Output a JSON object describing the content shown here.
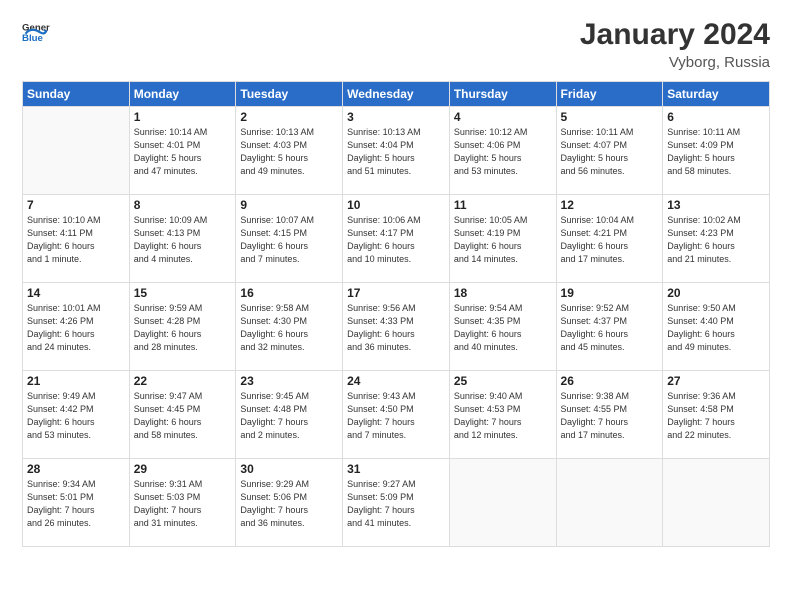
{
  "header": {
    "logo_general": "General",
    "logo_blue": "Blue",
    "month_year": "January 2024",
    "location": "Vyborg, Russia"
  },
  "weekdays": [
    "Sunday",
    "Monday",
    "Tuesday",
    "Wednesday",
    "Thursday",
    "Friday",
    "Saturday"
  ],
  "weeks": [
    [
      {
        "day": "",
        "info": ""
      },
      {
        "day": "1",
        "info": "Sunrise: 10:14 AM\nSunset: 4:01 PM\nDaylight: 5 hours\nand 47 minutes."
      },
      {
        "day": "2",
        "info": "Sunrise: 10:13 AM\nSunset: 4:03 PM\nDaylight: 5 hours\nand 49 minutes."
      },
      {
        "day": "3",
        "info": "Sunrise: 10:13 AM\nSunset: 4:04 PM\nDaylight: 5 hours\nand 51 minutes."
      },
      {
        "day": "4",
        "info": "Sunrise: 10:12 AM\nSunset: 4:06 PM\nDaylight: 5 hours\nand 53 minutes."
      },
      {
        "day": "5",
        "info": "Sunrise: 10:11 AM\nSunset: 4:07 PM\nDaylight: 5 hours\nand 56 minutes."
      },
      {
        "day": "6",
        "info": "Sunrise: 10:11 AM\nSunset: 4:09 PM\nDaylight: 5 hours\nand 58 minutes."
      }
    ],
    [
      {
        "day": "7",
        "info": "Sunrise: 10:10 AM\nSunset: 4:11 PM\nDaylight: 6 hours\nand 1 minute."
      },
      {
        "day": "8",
        "info": "Sunrise: 10:09 AM\nSunset: 4:13 PM\nDaylight: 6 hours\nand 4 minutes."
      },
      {
        "day": "9",
        "info": "Sunrise: 10:07 AM\nSunset: 4:15 PM\nDaylight: 6 hours\nand 7 minutes."
      },
      {
        "day": "10",
        "info": "Sunrise: 10:06 AM\nSunset: 4:17 PM\nDaylight: 6 hours\nand 10 minutes."
      },
      {
        "day": "11",
        "info": "Sunrise: 10:05 AM\nSunset: 4:19 PM\nDaylight: 6 hours\nand 14 minutes."
      },
      {
        "day": "12",
        "info": "Sunrise: 10:04 AM\nSunset: 4:21 PM\nDaylight: 6 hours\nand 17 minutes."
      },
      {
        "day": "13",
        "info": "Sunrise: 10:02 AM\nSunset: 4:23 PM\nDaylight: 6 hours\nand 21 minutes."
      }
    ],
    [
      {
        "day": "14",
        "info": "Sunrise: 10:01 AM\nSunset: 4:26 PM\nDaylight: 6 hours\nand 24 minutes."
      },
      {
        "day": "15",
        "info": "Sunrise: 9:59 AM\nSunset: 4:28 PM\nDaylight: 6 hours\nand 28 minutes."
      },
      {
        "day": "16",
        "info": "Sunrise: 9:58 AM\nSunset: 4:30 PM\nDaylight: 6 hours\nand 32 minutes."
      },
      {
        "day": "17",
        "info": "Sunrise: 9:56 AM\nSunset: 4:33 PM\nDaylight: 6 hours\nand 36 minutes."
      },
      {
        "day": "18",
        "info": "Sunrise: 9:54 AM\nSunset: 4:35 PM\nDaylight: 6 hours\nand 40 minutes."
      },
      {
        "day": "19",
        "info": "Sunrise: 9:52 AM\nSunset: 4:37 PM\nDaylight: 6 hours\nand 45 minutes."
      },
      {
        "day": "20",
        "info": "Sunrise: 9:50 AM\nSunset: 4:40 PM\nDaylight: 6 hours\nand 49 minutes."
      }
    ],
    [
      {
        "day": "21",
        "info": "Sunrise: 9:49 AM\nSunset: 4:42 PM\nDaylight: 6 hours\nand 53 minutes."
      },
      {
        "day": "22",
        "info": "Sunrise: 9:47 AM\nSunset: 4:45 PM\nDaylight: 6 hours\nand 58 minutes."
      },
      {
        "day": "23",
        "info": "Sunrise: 9:45 AM\nSunset: 4:48 PM\nDaylight: 7 hours\nand 2 minutes."
      },
      {
        "day": "24",
        "info": "Sunrise: 9:43 AM\nSunset: 4:50 PM\nDaylight: 7 hours\nand 7 minutes."
      },
      {
        "day": "25",
        "info": "Sunrise: 9:40 AM\nSunset: 4:53 PM\nDaylight: 7 hours\nand 12 minutes."
      },
      {
        "day": "26",
        "info": "Sunrise: 9:38 AM\nSunset: 4:55 PM\nDaylight: 7 hours\nand 17 minutes."
      },
      {
        "day": "27",
        "info": "Sunrise: 9:36 AM\nSunset: 4:58 PM\nDaylight: 7 hours\nand 22 minutes."
      }
    ],
    [
      {
        "day": "28",
        "info": "Sunrise: 9:34 AM\nSunset: 5:01 PM\nDaylight: 7 hours\nand 26 minutes."
      },
      {
        "day": "29",
        "info": "Sunrise: 9:31 AM\nSunset: 5:03 PM\nDaylight: 7 hours\nand 31 minutes."
      },
      {
        "day": "30",
        "info": "Sunrise: 9:29 AM\nSunset: 5:06 PM\nDaylight: 7 hours\nand 36 minutes."
      },
      {
        "day": "31",
        "info": "Sunrise: 9:27 AM\nSunset: 5:09 PM\nDaylight: 7 hours\nand 41 minutes."
      },
      {
        "day": "",
        "info": ""
      },
      {
        "day": "",
        "info": ""
      },
      {
        "day": "",
        "info": ""
      }
    ]
  ]
}
